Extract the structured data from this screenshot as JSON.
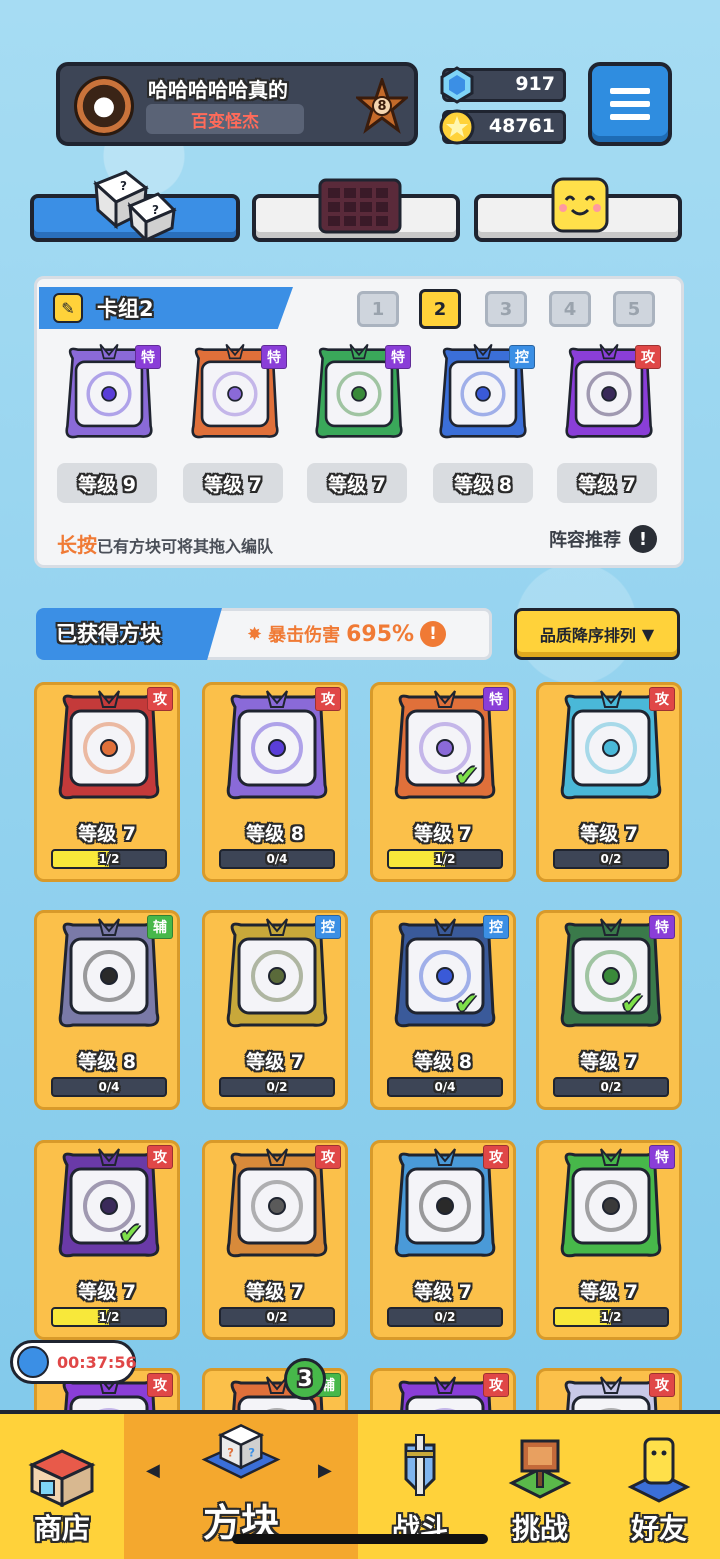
{
  "profile": {
    "name": "哈哈哈哈哈真的",
    "title": "百变怪杰",
    "rank": "8",
    "avatar_icon": "apple-logo-icon"
  },
  "currency": {
    "gems": "917",
    "coins": "48761"
  },
  "deck": {
    "name": "卡组2",
    "tabs": [
      "1",
      "2",
      "3",
      "4",
      "5"
    ],
    "active_tab": "2",
    "slots": [
      {
        "level": "等级 9",
        "tag": "特",
        "tag_color": "#8a3ed8",
        "frame": "#8a6ad8",
        "core": "#5a3ed8",
        "icon": "lightning-block-icon"
      },
      {
        "level": "等级 7",
        "tag": "特",
        "tag_color": "#8a3ed8",
        "frame": "#e0703a",
        "core": "#8a6ad8",
        "icon": "infinity-block-icon"
      },
      {
        "level": "等级 7",
        "tag": "特",
        "tag_color": "#8a3ed8",
        "frame": "#3aa85a",
        "core": "#3a8a3a",
        "icon": "pentagram-block-icon"
      },
      {
        "level": "等级 8",
        "tag": "控",
        "tag_color": "#3b8fe5",
        "frame": "#3b6fd8",
        "core": "#3a5ad8",
        "icon": "snowflake-block-icon"
      },
      {
        "level": "等级 7",
        "tag": "攻",
        "tag_color": "#e04747",
        "frame": "#8a3ed8",
        "core": "#3a2a5a",
        "icon": "orbit-block-icon"
      }
    ],
    "hint_highlight": "长按",
    "hint_text": "已有方块可将其拖入编队",
    "recommend_label": "阵容推荐"
  },
  "owned": {
    "label": "已获得方块",
    "crit_label": "暴击伤害",
    "crit_value": "695%",
    "sort_label": "品质降序排列"
  },
  "cards": [
    {
      "level": "等级 7",
      "progress": "1/2",
      "fill": 0.5,
      "tag": "攻",
      "tag_color": "#e04747",
      "frame": "#c43a3a",
      "core": "#e0703a",
      "checked": false,
      "icon": "star-burst-block-icon"
    },
    {
      "level": "等级 8",
      "progress": "0/4",
      "fill": 0,
      "tag": "攻",
      "tag_color": "#e04747",
      "frame": "#8a6ad8",
      "core": "#5a3ed8",
      "checked": false,
      "icon": "gear-block-icon"
    },
    {
      "level": "等级 7",
      "progress": "1/2",
      "fill": 0.5,
      "tag": "特",
      "tag_color": "#8a3ed8",
      "frame": "#e0703a",
      "core": "#8a6ad8",
      "checked": true,
      "icon": "infinity-block-icon"
    },
    {
      "level": "等级 7",
      "progress": "0/2",
      "fill": 0,
      "tag": "攻",
      "tag_color": "#e04747",
      "frame": "#4ab8d8",
      "core": "#4ab8d8",
      "checked": false,
      "icon": "trident-block-icon"
    },
    {
      "level": "等级 8",
      "progress": "0/4",
      "fill": 0,
      "tag": "辅",
      "tag_color": "#47b84a",
      "frame": "#7a7aa8",
      "core": "#2a2a2a",
      "checked": false,
      "icon": "teeth-block-icon"
    },
    {
      "level": "等级 7",
      "progress": "0/2",
      "fill": 0,
      "tag": "控",
      "tag_color": "#3b8fe5",
      "frame": "#c8a83a",
      "core": "#5a6a3a",
      "checked": false,
      "icon": "target-block-icon"
    },
    {
      "level": "等级 8",
      "progress": "0/4",
      "fill": 0,
      "tag": "控",
      "tag_color": "#3b8fe5",
      "frame": "#3a5a9a",
      "core": "#3a5ad8",
      "checked": true,
      "icon": "snowflake-block-icon"
    },
    {
      "level": "等级 7",
      "progress": "0/2",
      "fill": 0,
      "tag": "特",
      "tag_color": "#8a3ed8",
      "frame": "#3a7a4a",
      "core": "#3a8a3a",
      "checked": true,
      "icon": "pentagram-block-icon"
    },
    {
      "level": "等级 7",
      "progress": "1/2",
      "fill": 0.5,
      "tag": "攻",
      "tag_color": "#e04747",
      "frame": "#6a3aa8",
      "core": "#3a2a5a",
      "checked": true,
      "icon": "orbit-block-icon"
    },
    {
      "level": "等级 7",
      "progress": "0/2",
      "fill": 0,
      "tag": "攻",
      "tag_color": "#e04747",
      "frame": "#d88a3a",
      "core": "#5a5a5a",
      "checked": false,
      "icon": "pistol-block-icon"
    },
    {
      "level": "等级 7",
      "progress": "0/2",
      "fill": 0,
      "tag": "攻",
      "tag_color": "#e04747",
      "frame": "#4a9ad8",
      "core": "#2a2a2a",
      "checked": false,
      "icon": "vortex-block-icon"
    },
    {
      "level": "等级 7",
      "progress": "1/2",
      "fill": 0.5,
      "tag": "特",
      "tag_color": "#8a3ed8",
      "frame": "#47b84a",
      "core": "#3a3a3a",
      "checked": false,
      "icon": "vine-block-icon"
    },
    {
      "level": "",
      "progress": "",
      "fill": 0,
      "tag": "攻",
      "tag_color": "#e04747",
      "frame": "#8a3ed8",
      "core": "#8a6ad8",
      "checked": false,
      "icon": "block-icon"
    },
    {
      "level": "",
      "progress": "",
      "fill": 0,
      "tag": "辅",
      "tag_color": "#47b84a",
      "frame": "#e0703a",
      "core": "#5a5a5a",
      "checked": false,
      "icon": "block-icon"
    },
    {
      "level": "",
      "progress": "",
      "fill": 0,
      "tag": "攻",
      "tag_color": "#e04747",
      "frame": "#8a3ed8",
      "core": "#8a6ad8",
      "checked": false,
      "icon": "block-icon"
    },
    {
      "level": "",
      "progress": "",
      "fill": 0,
      "tag": "攻",
      "tag_color": "#e04747",
      "frame": "#c8c8e8",
      "core": "#5a5a5a",
      "checked": false,
      "icon": "block-icon"
    }
  ],
  "timer": "00:37:56",
  "blocks_badge": "3",
  "nav": [
    {
      "label": "商店",
      "icon": "shop-icon"
    },
    {
      "label": "方块",
      "icon": "mystery-cube-icon"
    },
    {
      "label": "战斗",
      "icon": "sword-shield-icon"
    },
    {
      "label": "挑战",
      "icon": "signboard-icon"
    },
    {
      "label": "好友",
      "icon": "friend-figure-icon"
    }
  ],
  "colors": {
    "accent_blue": "#3b8fe5",
    "accent_yellow": "#ffd23a",
    "card_bg": "#fbc04a",
    "dark": "#1f2430"
  }
}
